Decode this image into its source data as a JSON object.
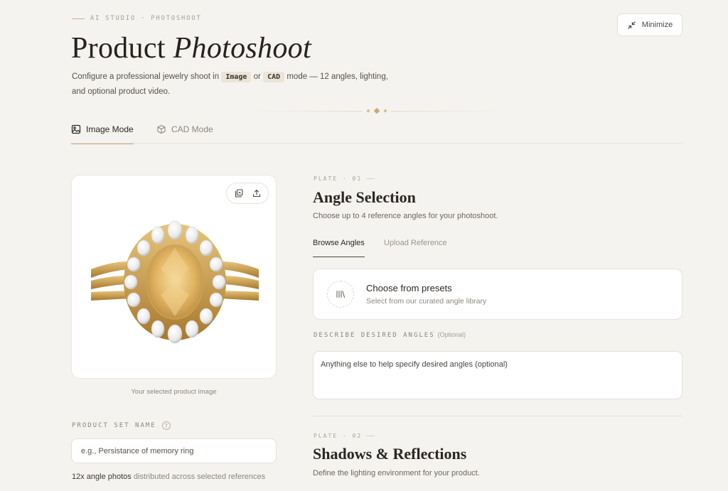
{
  "header": {
    "eyebrow": "AI STUDIO · PHOTOSHOOT",
    "title_plain": "Product",
    "title_italic": "Photoshoot",
    "description_prefix": "Configure a professional jewelry shoot in",
    "code_image": "Image",
    "description_or": "or",
    "code_cad": "CAD",
    "description_suffix": "mode — 12 angles, lighting, and optional product video.",
    "minimize_label": "Minimize"
  },
  "tabs": [
    {
      "label": "Image Mode",
      "icon": "image-icon",
      "active": true
    },
    {
      "label": "CAD Mode",
      "icon": "cube-icon",
      "active": false
    }
  ],
  "product": {
    "image_alt": "gold ring with yellow oval center stone and diamond halo",
    "caption": "Your selected product image",
    "set_name_label": "PRODUCT SET NAME",
    "set_name_placeholder": "e.g., Persistance of memory ring",
    "note_bold": "12x angle photos",
    "note_rest": "distributed across selected references"
  },
  "plate1": {
    "plate_label": "PLATE · 01",
    "title": "Angle Selection",
    "subtitle": "Choose up to 4 reference angles for your photoshoot.",
    "subtabs": [
      "Browse Angles",
      "Upload Reference"
    ],
    "preset_title": "Choose from presets",
    "preset_sub": "Select from our curated angle library",
    "describe_label": "DESCRIBE DESIRED ANGLES",
    "describe_optional": "(Optional)",
    "describe_placeholder": "Anything else to help specify desired angles (optional)"
  },
  "plate2": {
    "plate_label": "PLATE · 02",
    "title": "Shadows & Reflections",
    "subtitle": "Define the lighting environment for your product."
  },
  "colors": {
    "background": "#f5f3ef",
    "accent_gold": "#c9a87a",
    "text_dark": "#2a2723",
    "text_muted": "#8d877f"
  }
}
